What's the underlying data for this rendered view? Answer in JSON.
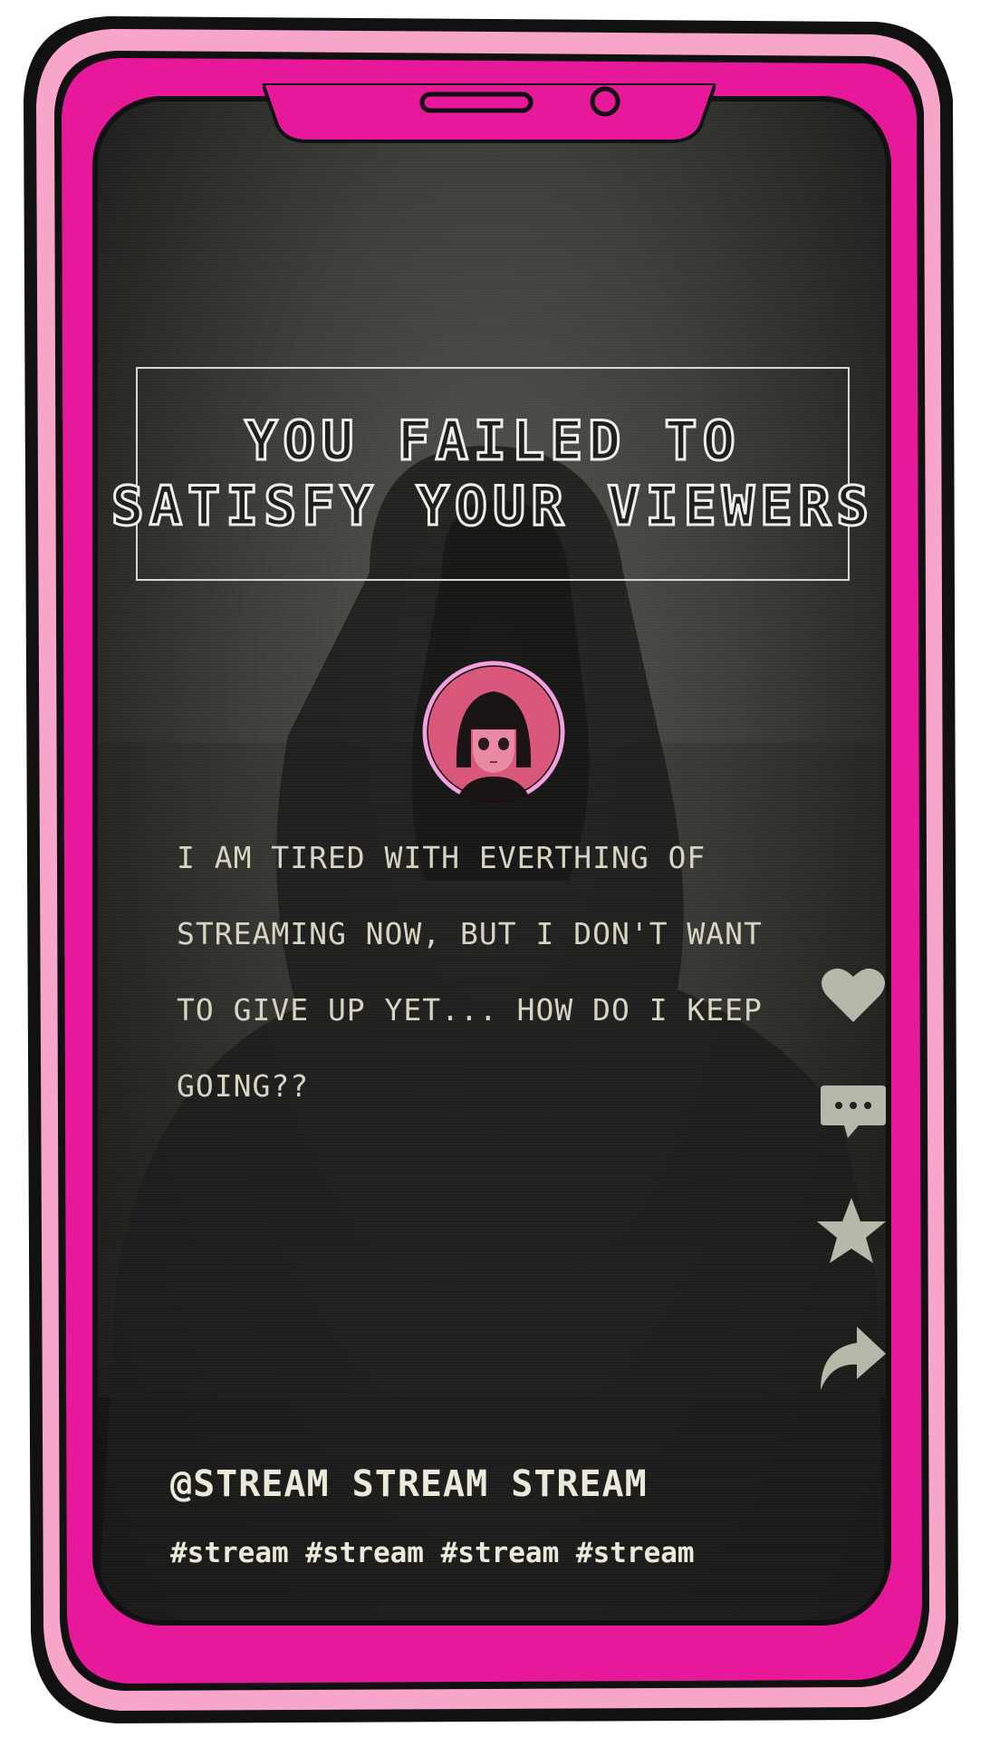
{
  "banner": {
    "line1": "YOU FAILED TO",
    "line2": "SATISFY YOUR VIEWERS"
  },
  "post": {
    "message": "I AM TIRED WITH EVERTHING OF STREAMING NOW, BUT I DON'T WANT TO GIVE UP YET... HOW DO I KEEP GOING??",
    "handle": "@STREAM STREAM STREAM",
    "tags": "#stream #stream #stream #stream"
  },
  "icons": {
    "like": "heart-icon",
    "comment": "comment-icon",
    "favorite": "star-icon",
    "share": "share-icon"
  },
  "colors": {
    "frame_magenta": "#e8189a",
    "frame_pink": "#f7a6c9",
    "outline": "#111111",
    "avatar_pink": "#d9577a",
    "text_cream": "#d9d4c2"
  }
}
